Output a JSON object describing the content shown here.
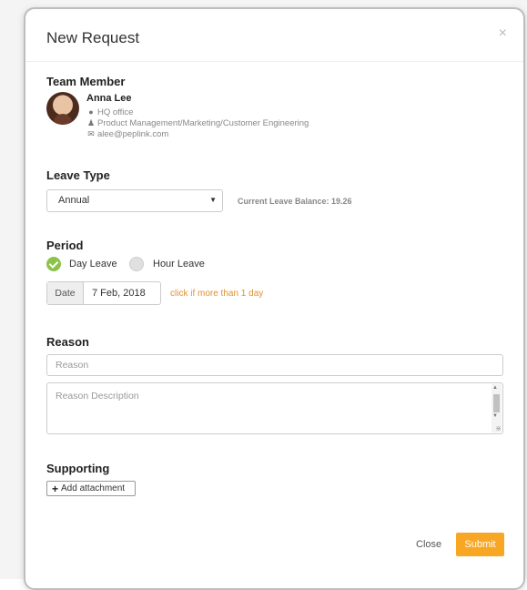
{
  "modal": {
    "title": "New Request",
    "close_glyph": "×"
  },
  "team_member": {
    "section_label": "Team Member",
    "name": "Anna Lee",
    "office": "HQ office",
    "department": "Product Management/Marketing/Customer Engineering",
    "email": "alee@peplink.com",
    "icons": {
      "office": "location-pin-icon",
      "department": "user-tie-icon",
      "email": "envelope-icon"
    }
  },
  "leave_type": {
    "section_label": "Leave Type",
    "selected": "Annual",
    "balance": "Current Leave Balance: 19.26"
  },
  "period": {
    "section_label": "Period",
    "options": [
      {
        "label": "Day Leave",
        "checked": true
      },
      {
        "label": "Hour Leave",
        "checked": false
      }
    ],
    "date_addon": "Date",
    "date_value": "7 Feb, 2018",
    "multi_day_link": "click if more than 1 day"
  },
  "reason": {
    "section_label": "Reason",
    "placeholder": "Reason",
    "description_placeholder": "Reason Description"
  },
  "supporting": {
    "section_label": "Supporting",
    "attach_label": "Add attachment"
  },
  "footer": {
    "close_label": "Close",
    "submit_label": "Submit"
  },
  "colors": {
    "accent_orange": "#f7a723",
    "link_orange": "#e0922f",
    "check_green": "#8bc34a"
  }
}
